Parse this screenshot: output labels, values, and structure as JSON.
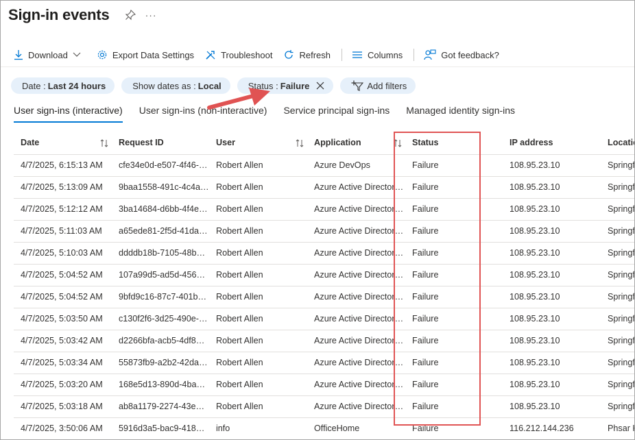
{
  "page": {
    "title": "Sign-in events"
  },
  "toolbar": {
    "download": "Download",
    "export": "Export Data Settings",
    "troubleshoot": "Troubleshoot",
    "refresh": "Refresh",
    "columns": "Columns",
    "feedback": "Got feedback?"
  },
  "filters": {
    "date_key": "Date :",
    "date_val": "Last 24 hours",
    "dates_key": "Show dates as :",
    "dates_val": "Local",
    "status_key": "Status :",
    "status_val": "Failure",
    "add": "Add filters"
  },
  "tabs": [
    "User sign-ins (interactive)",
    "User sign-ins (non-interactive)",
    "Service principal sign-ins",
    "Managed identity sign-ins"
  ],
  "columns": [
    "Date",
    "Request ID",
    "User",
    "Application",
    "Status",
    "IP address",
    "Location"
  ],
  "rows": [
    [
      "4/7/2025, 6:15:13 AM",
      "cfe34e0d-e507-4f46-…",
      "Robert Allen",
      "Azure DevOps",
      "Failure",
      "108.95.23.10",
      "Springf"
    ],
    [
      "4/7/2025, 5:13:09 AM",
      "9baa1558-491c-4c4a…",
      "Robert Allen",
      "Azure Active Director…",
      "Failure",
      "108.95.23.10",
      "Springf"
    ],
    [
      "4/7/2025, 5:12:12 AM",
      "3ba14684-d6bb-4f4e…",
      "Robert Allen",
      "Azure Active Director…",
      "Failure",
      "108.95.23.10",
      "Springf"
    ],
    [
      "4/7/2025, 5:11:03 AM",
      "a65ede81-2f5d-41da…",
      "Robert Allen",
      "Azure Active Director…",
      "Failure",
      "108.95.23.10",
      "Springf"
    ],
    [
      "4/7/2025, 5:10:03 AM",
      "ddddb18b-7105-48b…",
      "Robert Allen",
      "Azure Active Director…",
      "Failure",
      "108.95.23.10",
      "Springf"
    ],
    [
      "4/7/2025, 5:04:52 AM",
      "107a99d5-ad5d-456…",
      "Robert Allen",
      "Azure Active Director…",
      "Failure",
      "108.95.23.10",
      "Springf"
    ],
    [
      "4/7/2025, 5:04:52 AM",
      "9bfd9c16-87c7-401b…",
      "Robert Allen",
      "Azure Active Director…",
      "Failure",
      "108.95.23.10",
      "Springf"
    ],
    [
      "4/7/2025, 5:03:50 AM",
      "c130f2f6-3d25-490e-…",
      "Robert Allen",
      "Azure Active Director…",
      "Failure",
      "108.95.23.10",
      "Springf"
    ],
    [
      "4/7/2025, 5:03:42 AM",
      "d2266bfa-acb5-4df8…",
      "Robert Allen",
      "Azure Active Director…",
      "Failure",
      "108.95.23.10",
      "Springf"
    ],
    [
      "4/7/2025, 5:03:34 AM",
      "55873fb9-a2b2-42da…",
      "Robert Allen",
      "Azure Active Director…",
      "Failure",
      "108.95.23.10",
      "Springf"
    ],
    [
      "4/7/2025, 5:03:20 AM",
      "168e5d13-890d-4ba…",
      "Robert Allen",
      "Azure Active Director…",
      "Failure",
      "108.95.23.10",
      "Springf"
    ],
    [
      "4/7/2025, 5:03:18 AM",
      "ab8a1179-2274-43e1…",
      "Robert Allen",
      "Azure Active Director…",
      "Failure",
      "108.95.23.10",
      "Springf"
    ],
    [
      "4/7/2025, 3:50:06 AM",
      "5916d3a5-bac9-4186…",
      "info",
      "OfficeHome",
      "Failure",
      "116.212.144.236",
      "Phsar K"
    ]
  ],
  "colors": {
    "accent": "#0078d4",
    "pill": "#e6f0fa",
    "annotation": "#e05353"
  }
}
